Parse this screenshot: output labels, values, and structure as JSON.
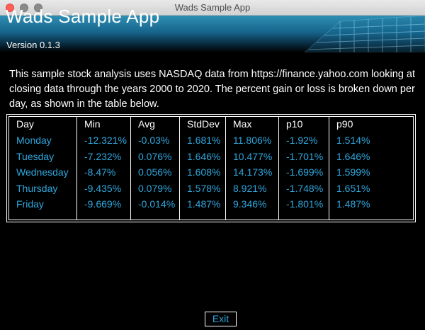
{
  "window": {
    "title": "Wads Sample App"
  },
  "header": {
    "app_title": "Wads Sample App",
    "version": "Version 0.1.3"
  },
  "description": "This sample stock analysis uses NASDAQ data from https://finance.yahoo.com looking at closing data through the years 2000 to 2020. The percent gain or loss is broken down per day, as shown in the table below.",
  "table": {
    "columns": [
      "Day",
      "Min",
      "Avg",
      "StdDev",
      "Max",
      "p10",
      "p90"
    ],
    "rows": [
      [
        "Monday",
        "-12.321%",
        "-0.03%",
        "1.681%",
        "11.806%",
        "-1.92%",
        "1.514%"
      ],
      [
        "Tuesday",
        "-7.232%",
        "0.076%",
        "1.646%",
        "10.477%",
        "-1.701%",
        "1.646%"
      ],
      [
        "Wednesday",
        "-8.47%",
        "0.056%",
        "1.608%",
        "14.173%",
        "-1.699%",
        "1.599%"
      ],
      [
        "Thursday",
        "-9.435%",
        "0.079%",
        "1.578%",
        "8.921%",
        "-1.748%",
        "1.651%"
      ],
      [
        "Friday",
        "-9.669%",
        "-0.014%",
        "1.487%",
        "9.346%",
        "-1.801%",
        "1.487%"
      ]
    ]
  },
  "buttons": {
    "exit_label": "Exit"
  },
  "colors": {
    "background": "#000000",
    "value_text": "#2ea7dd",
    "header_text": "#ffffff",
    "banner_top": "#2f8fb4"
  }
}
